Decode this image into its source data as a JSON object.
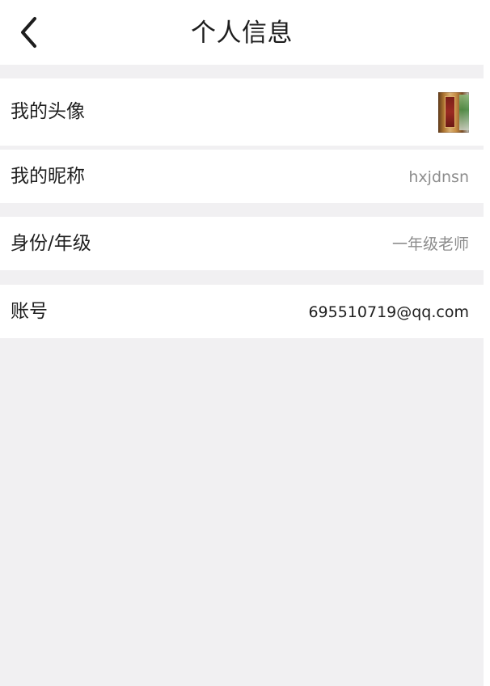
{
  "header": {
    "title": "个人信息",
    "back_icon": "chevron-left-icon"
  },
  "profile": {
    "avatar_label": "我的头像",
    "avatar_image": "avatar-thumbnail",
    "nickname_label": "我的昵称",
    "nickname_value": "hxjdnsn",
    "identity_label": "身份/年级",
    "identity_value": "一年级老师",
    "account_label": "账号",
    "account_value": "695510719@qq.com"
  },
  "colors": {
    "background": "#f1f0f2",
    "surface": "#ffffff",
    "primary_text": "#1f1f1f",
    "secondary_text": "#8d8d8d"
  }
}
